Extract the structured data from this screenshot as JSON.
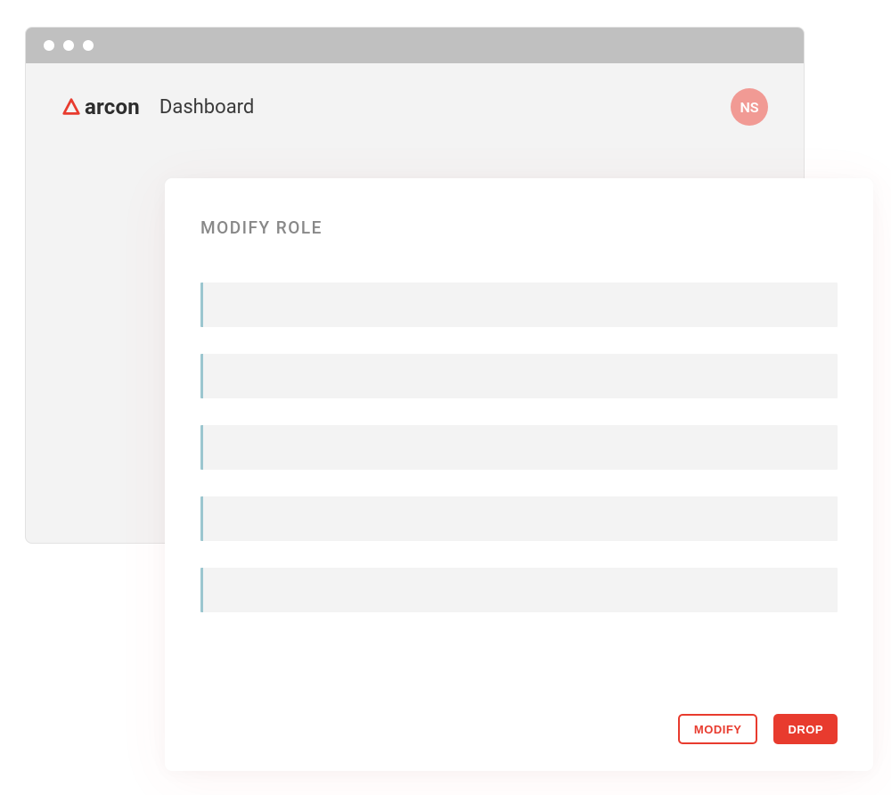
{
  "brand": {
    "name": "arcon"
  },
  "header": {
    "page_title": "Dashboard",
    "avatar_initials": "NS"
  },
  "modal": {
    "title": "MODIFY ROLE",
    "inputs": [
      {
        "value": ""
      },
      {
        "value": ""
      },
      {
        "value": ""
      },
      {
        "value": ""
      },
      {
        "value": ""
      }
    ],
    "buttons": {
      "modify": "MODIFY",
      "drop": "DROP"
    }
  },
  "colors": {
    "accent": "#e83b2e",
    "avatar_bg": "#f19a94",
    "input_accent": "#9bc6cf"
  }
}
